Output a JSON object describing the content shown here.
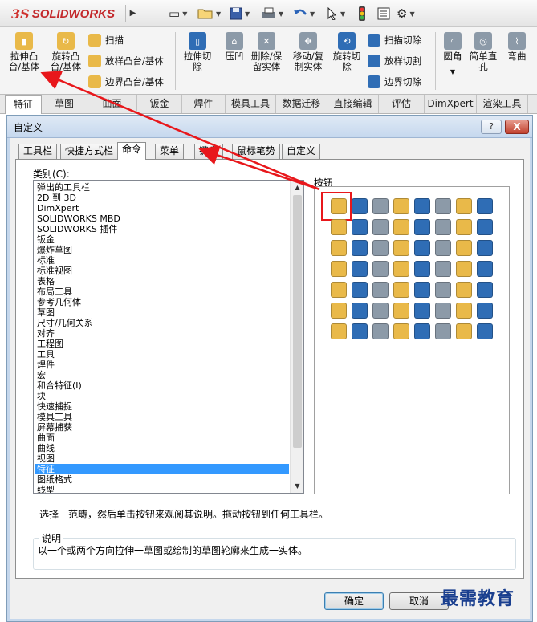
{
  "app": {
    "logo_prefix": "3S",
    "logo_name": "SOLIDWORKS"
  },
  "quick_access": {
    "icons": [
      "new-document-icon",
      "open-folder-icon",
      "save-icon",
      "print-icon",
      "undo-icon",
      "select-pointer-icon",
      "rebuild-traffic-light-icon",
      "file-properties-icon",
      "options-gear-icon"
    ]
  },
  "command_manager": {
    "buttons": {
      "extruded_boss": "拉伸凸台/基体",
      "revolved_boss": "旋转凸台/基体",
      "swept_boss": "扫描",
      "lofted_boss": "放样凸台/基体",
      "boundary_boss": "边界凸台/基体",
      "extruded_cut": "拉伸切除",
      "indent": "压凹",
      "delete_keep_body": "删除/保留实体",
      "move_copy_body": "移动/复制实体",
      "revolved_cut": "旋转切除",
      "swept_cut": "扫描切除",
      "lofted_cut": "放样切割",
      "boundary_cut": "边界切除",
      "fillet": "圆角",
      "simple_hole": "简单直孔",
      "flex": "弯曲"
    },
    "tabs": [
      "特征",
      "草图",
      "曲面",
      "钣金",
      "焊件",
      "模具工具",
      "数据迁移",
      "直接编辑",
      "评估",
      "DimXpert",
      "渲染工具"
    ]
  },
  "dialog": {
    "title": "自定义",
    "help_label": "?",
    "close_label": "X",
    "tabs": [
      "工具栏",
      "快捷方式栏",
      "命令",
      "菜单",
      "键盘",
      "鼠标笔势",
      "自定义"
    ],
    "active_tab": "命令",
    "category_label": "类别(C):",
    "buttons_label": "按钮",
    "categories": [
      "弹出的工具栏",
      "2D 到 3D",
      "DimXpert",
      "SOLIDWORKS MBD",
      "SOLIDWORKS 插件",
      "钣金",
      "爆炸草图",
      "标准",
      "标准视图",
      "表格",
      "布局工具",
      "参考几何体",
      "草图",
      "尺寸/几何关系",
      "对齐",
      "工程图",
      "工具",
      "焊件",
      "宏",
      "和合特征(I)",
      "块",
      "快速捕捉",
      "模具工具",
      "屏幕捕获",
      "曲面",
      "曲线",
      "视图",
      "特征",
      "图纸格式",
      "线型"
    ],
    "selected_category": "特征",
    "hint": "选择一范畴，然后单击按钮来观阅其说明。拖动按钮到任何工具栏。",
    "description_label": "说明",
    "description": "以一个或两个方向拉伸一草图或绘制的草图轮廓来生成一实体。",
    "ok_label": "确定",
    "cancel_label": "取消"
  },
  "watermark": "最需教育",
  "colors": {
    "selection": "#3399ff",
    "annotation_red": "#e8171b",
    "feature_yellow": "#e9b949",
    "feature_blue": "#2f6db5",
    "feature_gray": "#8c9aa8"
  }
}
